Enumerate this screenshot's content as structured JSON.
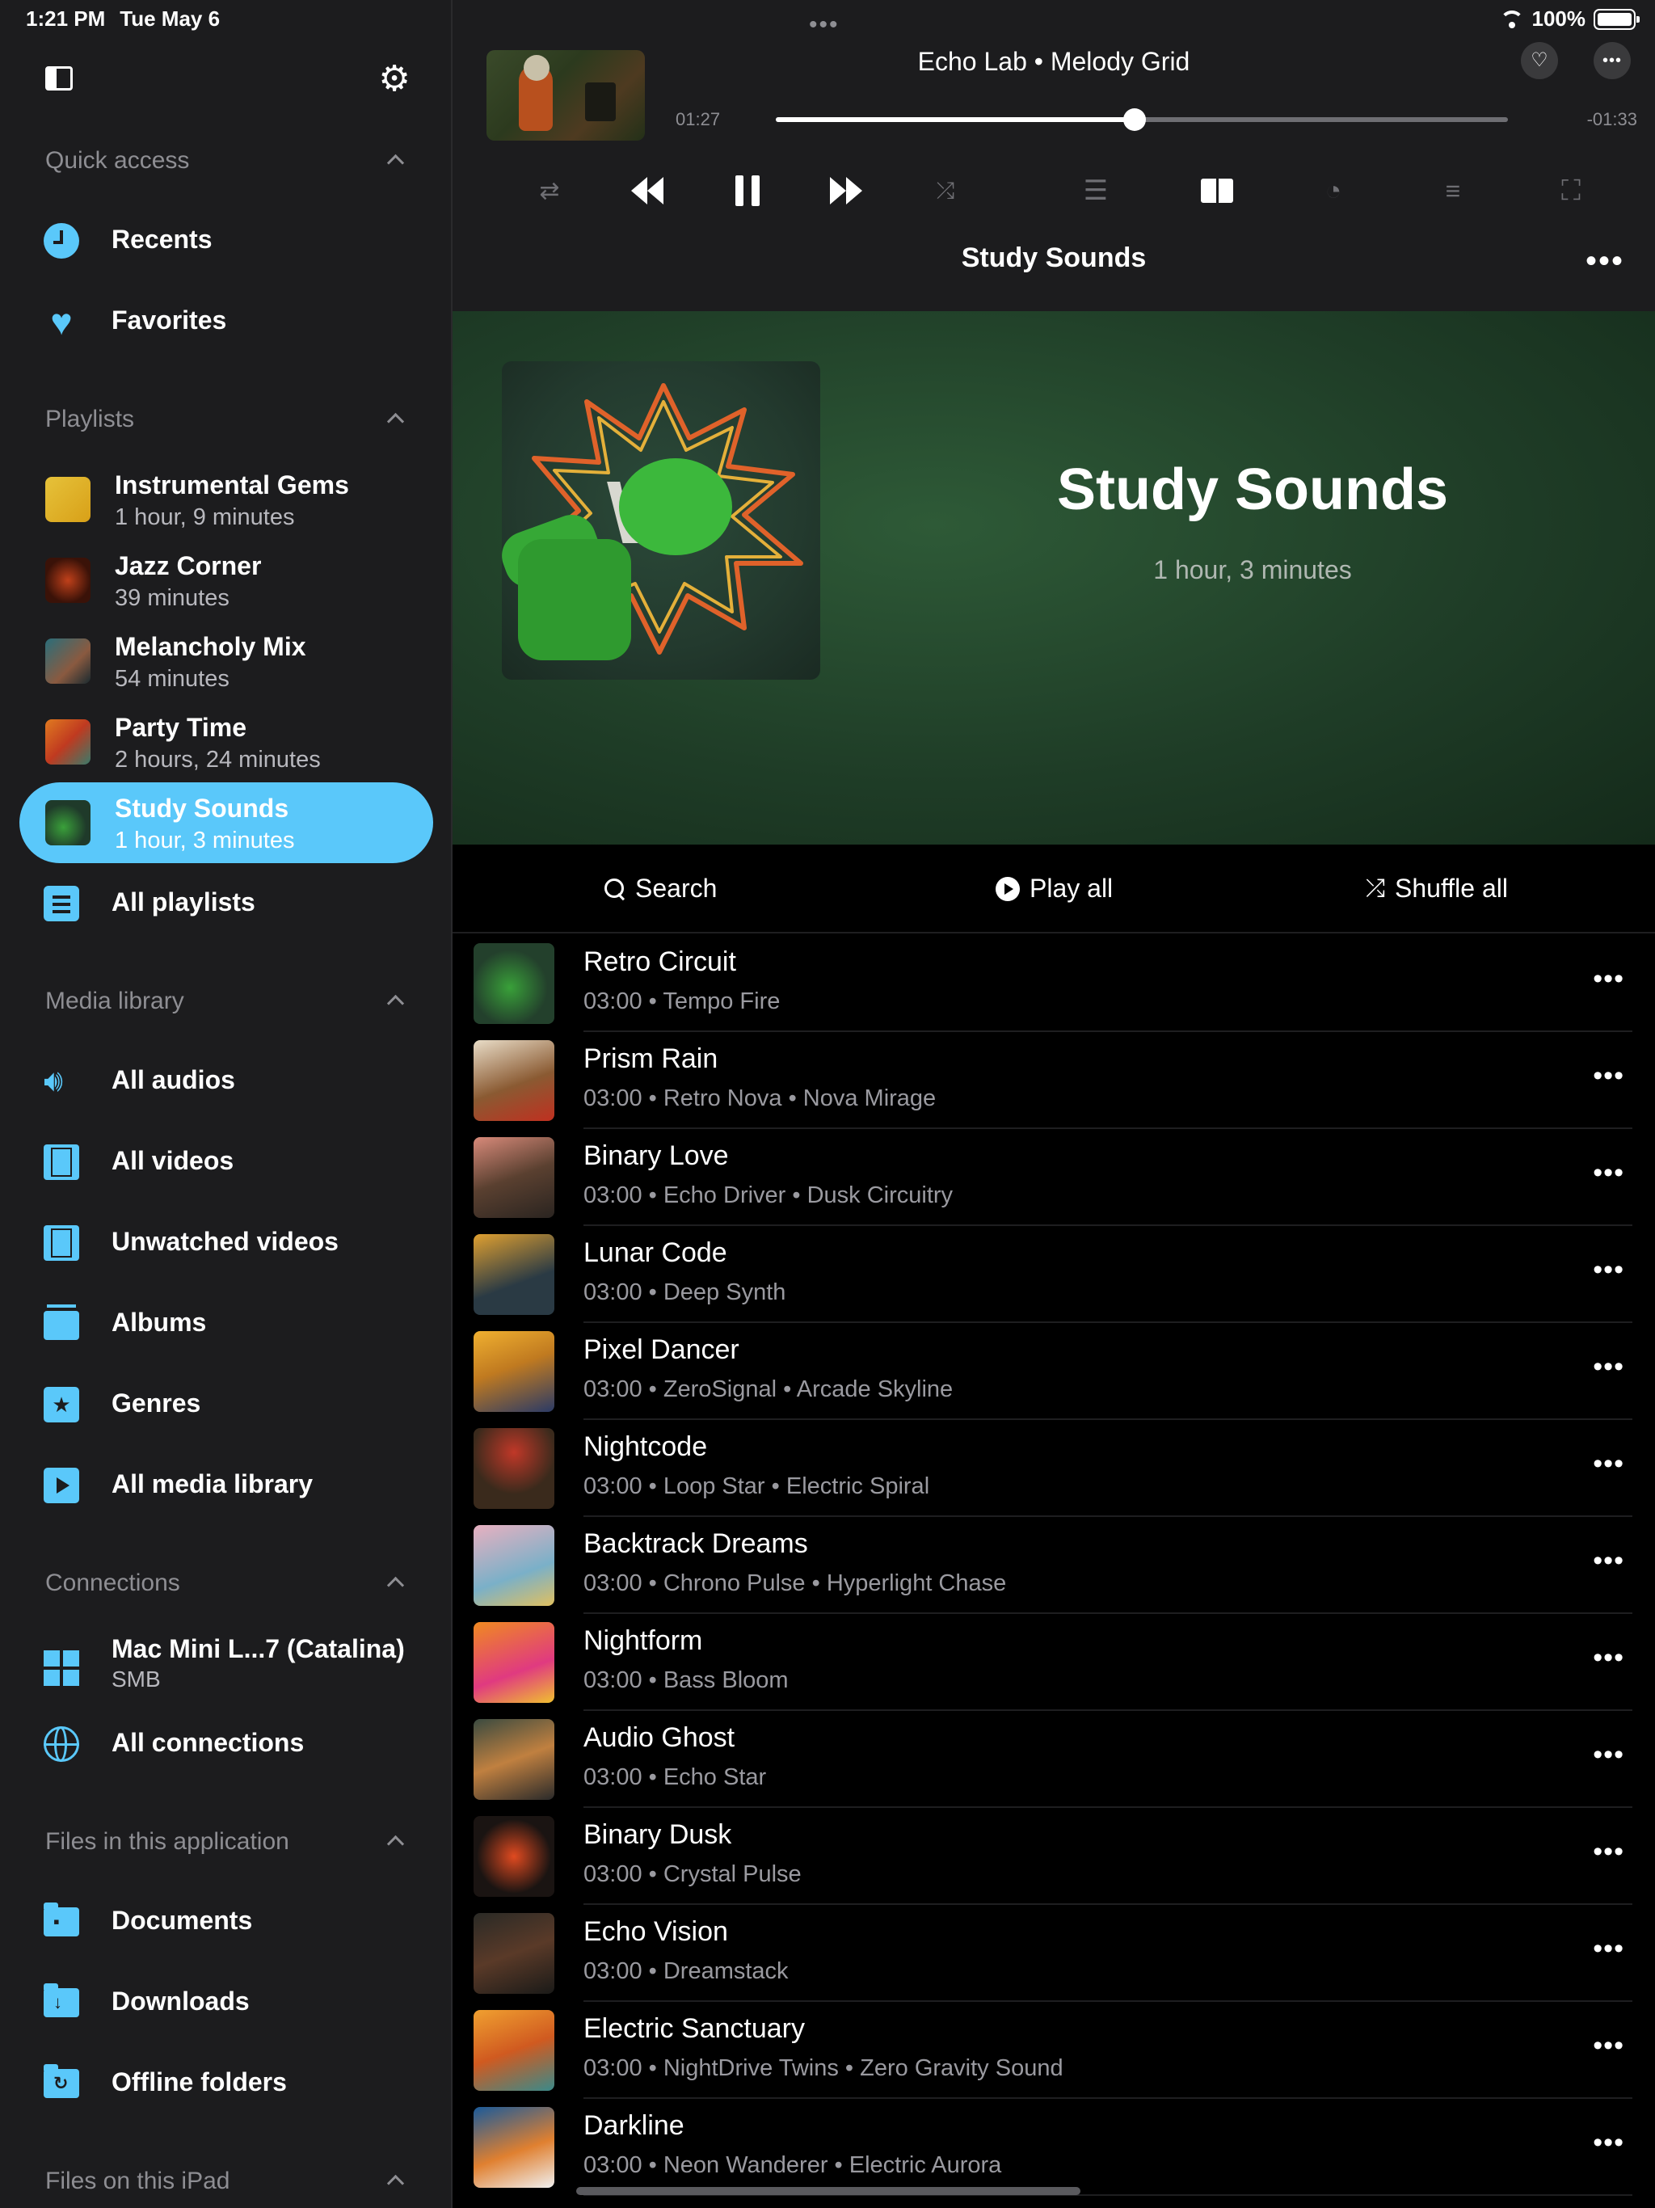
{
  "status": {
    "time": "1:21 PM",
    "date": "Tue May 6",
    "battery": "100%"
  },
  "sidebar": {
    "sections": {
      "quick_access": "Quick access",
      "playlists": "Playlists",
      "media_library": "Media library",
      "connections": "Connections",
      "files_app": "Files in this application",
      "files_ipad": "Files on this iPad"
    },
    "quick": [
      {
        "label": "Recents",
        "icon": "clock-icon"
      },
      {
        "label": "Favorites",
        "icon": "heart-icon"
      }
    ],
    "playlists": [
      {
        "name": "Instrumental Gems",
        "duration": "1 hour, 9 minutes",
        "active": false
      },
      {
        "name": "Jazz Corner",
        "duration": "39 minutes",
        "active": false
      },
      {
        "name": "Melancholy Mix",
        "duration": "54 minutes",
        "active": false
      },
      {
        "name": "Party Time",
        "duration": "2 hours, 24 minutes",
        "active": false
      },
      {
        "name": "Study Sounds",
        "duration": "1 hour, 3 minutes",
        "active": true
      }
    ],
    "all_playlists": "All playlists",
    "media": [
      {
        "label": "All audios",
        "icon": "speaker-icon"
      },
      {
        "label": "All videos",
        "icon": "film-icon"
      },
      {
        "label": "Unwatched videos",
        "icon": "film-icon"
      },
      {
        "label": "Albums",
        "icon": "albums-icon"
      },
      {
        "label": "Genres",
        "icon": "star-icon"
      },
      {
        "label": "All media library",
        "icon": "media-play-icon"
      }
    ],
    "connection": {
      "name": "Mac Mini L...7 (Catalina)",
      "type": "SMB"
    },
    "all_connections": "All connections",
    "files": [
      {
        "label": "Documents",
        "icon": "document-folder-icon"
      },
      {
        "label": "Downloads",
        "icon": "download-folder-icon"
      },
      {
        "label": "Offline folders",
        "icon": "sync-folder-icon"
      }
    ]
  },
  "player": {
    "title": "Echo Lab • Melody Grid",
    "elapsed": "01:27",
    "remaining": "-01:33",
    "progress": 0.49
  },
  "playlist": {
    "header": "Study Sounds",
    "title": "Study Sounds",
    "duration": "1 hour, 3 minutes",
    "actions": {
      "search": "Search",
      "play_all": "Play all",
      "shuffle_all": "Shuffle all"
    },
    "accent": "#5ac8fa",
    "tracks": [
      {
        "title": "Retro Circuit",
        "meta": "03:00 • Tempo Fire"
      },
      {
        "title": "Prism Rain",
        "meta": "03:00 • Retro Nova • Nova Mirage"
      },
      {
        "title": "Binary Love",
        "meta": "03:00 • Echo Driver • Dusk Circuitry"
      },
      {
        "title": "Lunar Code",
        "meta": "03:00 • Deep Synth"
      },
      {
        "title": "Pixel Dancer",
        "meta": "03:00 • ZeroSignal • Arcade Skyline"
      },
      {
        "title": "Nightcode",
        "meta": "03:00 • Loop Star • Electric Spiral"
      },
      {
        "title": "Backtrack Dreams",
        "meta": "03:00 • Chrono Pulse • Hyperlight Chase"
      },
      {
        "title": "Nightform",
        "meta": "03:00 • Bass Bloom"
      },
      {
        "title": "Audio Ghost",
        "meta": "03:00 • Echo Star"
      },
      {
        "title": "Binary Dusk",
        "meta": "03:00 • Crystal Pulse"
      },
      {
        "title": "Echo Vision",
        "meta": "03:00 • Dreamstack"
      },
      {
        "title": "Electric Sanctuary",
        "meta": "03:00 • NightDrive Twins • Zero Gravity Sound"
      },
      {
        "title": "Darkline",
        "meta": "03:00 • Neon Wanderer • Electric Aurora"
      }
    ]
  }
}
